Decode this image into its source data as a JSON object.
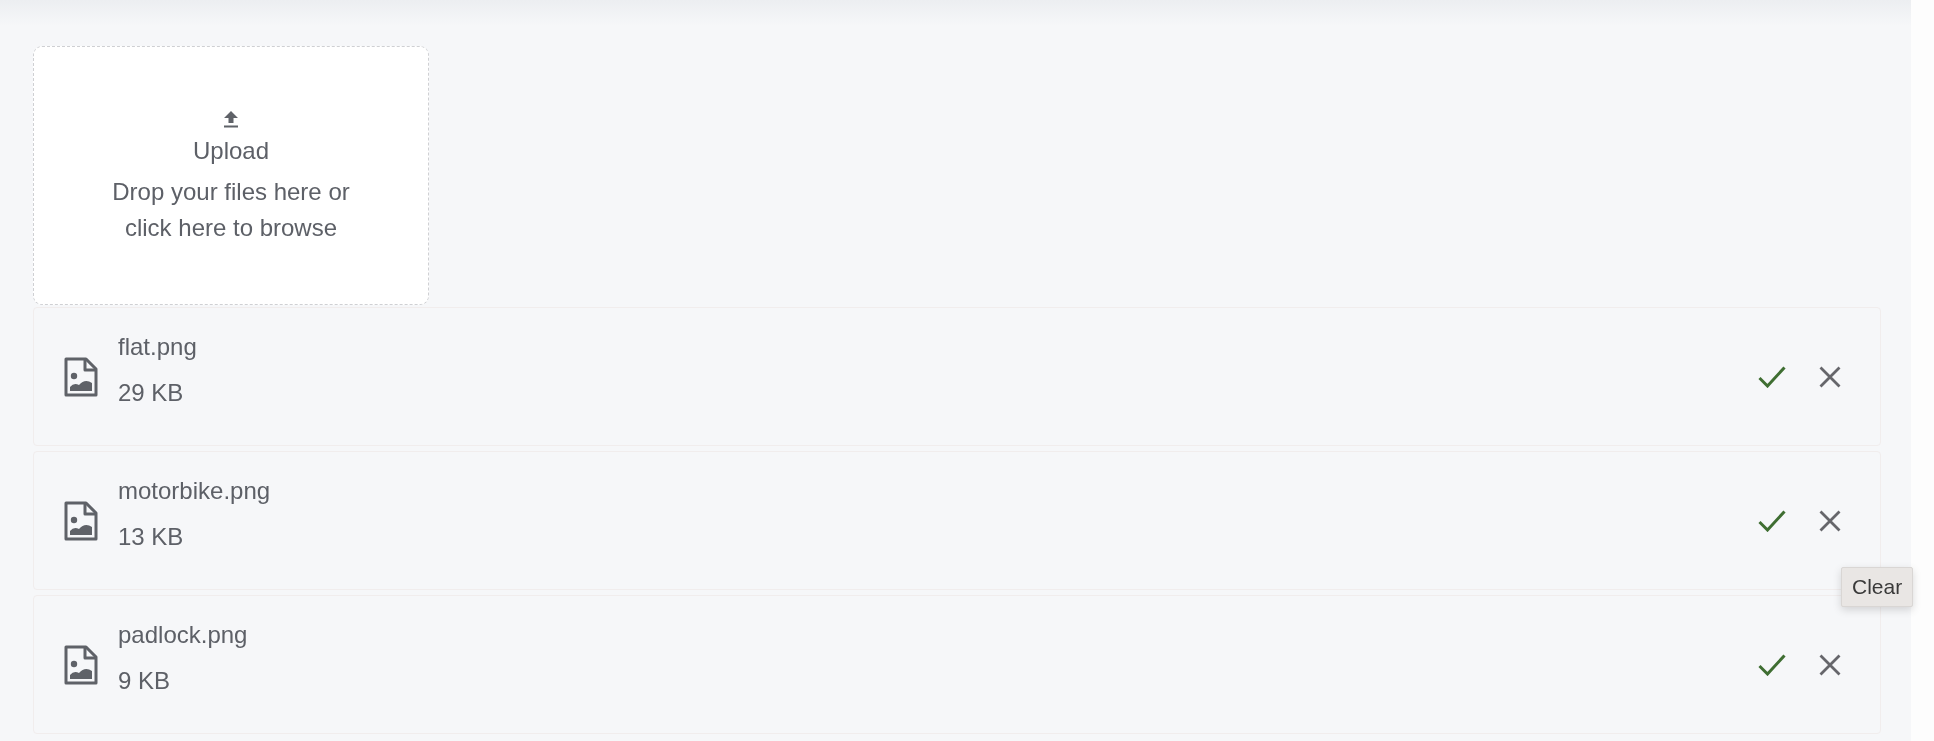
{
  "upload": {
    "title": "Upload",
    "hint": "Drop your files here or click here to browse"
  },
  "files": [
    {
      "name": "flat.png",
      "size": "29 KB",
      "uploaded": true
    },
    {
      "name": "motorbike.png",
      "size": "13 KB",
      "uploaded": true,
      "tooltip": "Clear"
    },
    {
      "name": "padlock.png",
      "size": "9 KB",
      "uploaded": true
    }
  ]
}
